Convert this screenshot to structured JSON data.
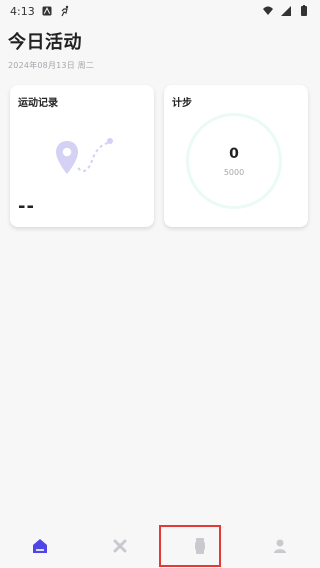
{
  "status_bar": {
    "time": "4:13"
  },
  "header": {
    "title": "今日活动",
    "date": "2024年08月13日 周二"
  },
  "cards": {
    "exercise": {
      "title": "运动记录",
      "value": "--"
    },
    "steps": {
      "title": "计步",
      "count": "0",
      "goal": "5000"
    }
  },
  "colors": {
    "accent": "#4f46e5",
    "ring": "#e9fbf3",
    "map_pin": "#c7c4f2",
    "highlight": "#e53935"
  },
  "bottom_nav": {
    "items": [
      {
        "icon": "home-icon",
        "active": true
      },
      {
        "icon": "sport-icon",
        "active": false
      },
      {
        "icon": "watch-icon",
        "active": false,
        "highlighted": true
      },
      {
        "icon": "profile-icon",
        "active": false
      }
    ]
  }
}
